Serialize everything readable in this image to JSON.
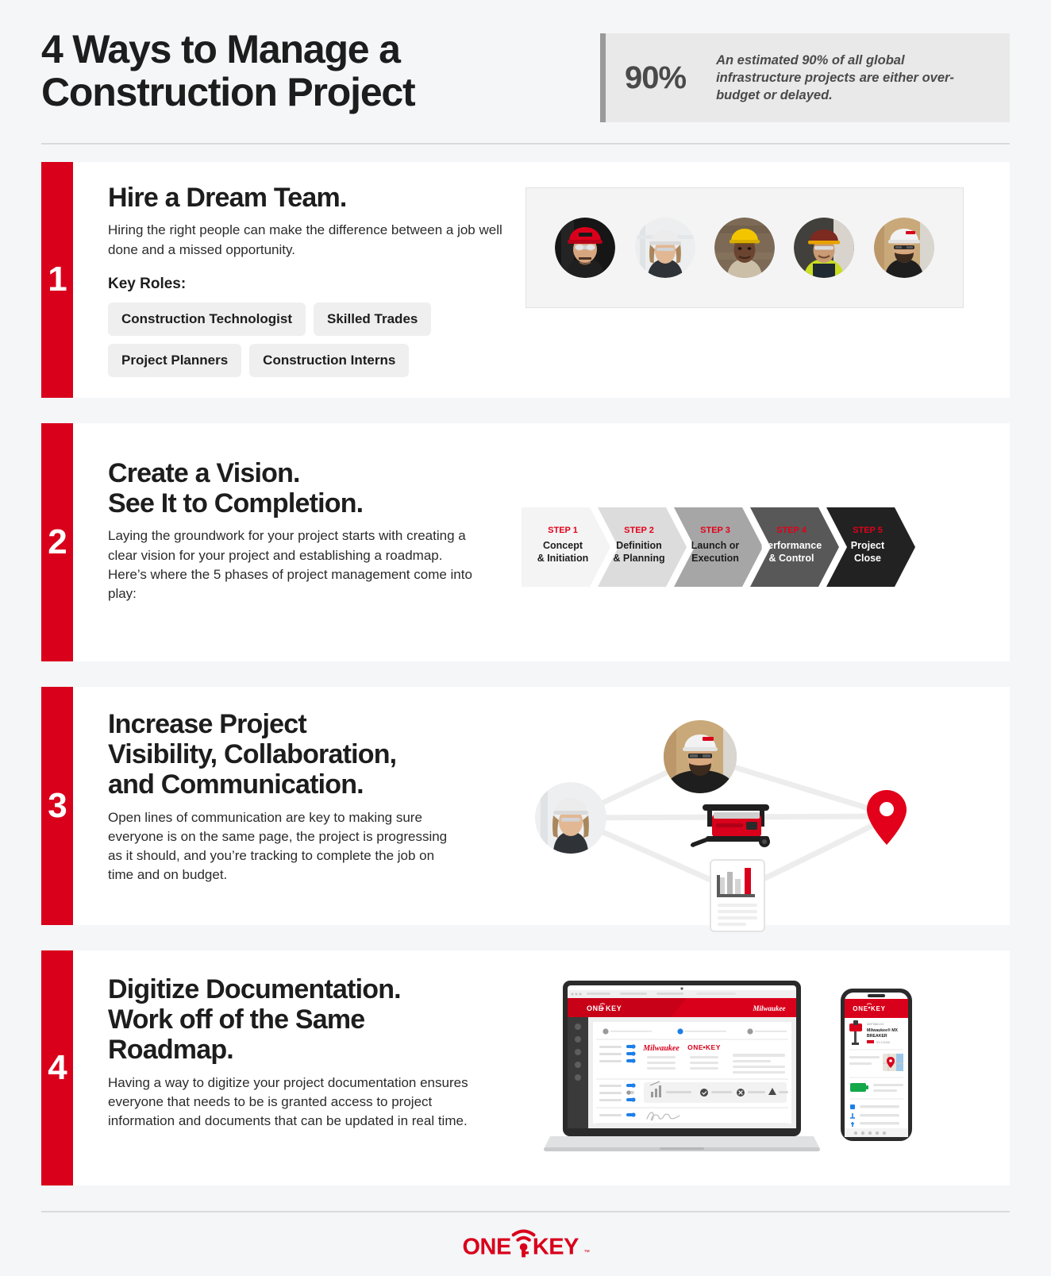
{
  "header": {
    "title_line1": "4 Ways to Manage a",
    "title_line2": "Construction Project",
    "stat_number": "90%",
    "stat_text": "An estimated 90% of all global infrastructure projects are either over-budget or delayed."
  },
  "sections": [
    {
      "number": "1",
      "title_lines": [
        "Hire a Dream Team."
      ],
      "description": "Hiring the right people can make the difference between a job well done and a missed opportunity.",
      "sub_label": "Key Roles:",
      "pills": [
        "Construction Technologist",
        "Skilled Trades",
        "Project Planners",
        "Construction Interns"
      ],
      "art": "team-photo-strip",
      "avatars": [
        {
          "name": "worker-red-hardhat",
          "helmet": "#d9001b",
          "skin": "#d7a67f",
          "bg": "#1a1a1a",
          "hair": "#3a2a1c"
        },
        {
          "name": "worker-white-hardhat-female",
          "helmet": "#e8e8e8",
          "skin": "#e2b894",
          "bg": "#e9ebec",
          "hair": "#a9865c"
        },
        {
          "name": "worker-yellow-hardhat",
          "helmet": "#f2c500",
          "skin": "#6b4430",
          "bg": "#7a6654",
          "hair": "#271a12"
        },
        {
          "name": "worker-brown-hardhat",
          "helmet": "#7d2a20",
          "skin": "#c99a73",
          "bg": "#3d3a36",
          "hair": "#2b2118"
        },
        {
          "name": "worker-white-hardhat-beard",
          "helmet": "#f2f2f2",
          "skin": "#d8a87e",
          "bg": "#c9a979",
          "hair": "#3b2b1e"
        }
      ]
    },
    {
      "number": "2",
      "title_lines": [
        "Create a Vision.",
        "See It to Completion."
      ],
      "description": "Laying the groundwork for your project starts with creating a clear vision for your project and establishing a roadmap. Here’s where the 5 phases of project management come into play:",
      "art": "process-chevrons"
    },
    {
      "number": "3",
      "title_lines": [
        "Increase Project",
        "Visibility, Collaboration,",
        "and Communication."
      ],
      "description": "Open lines of communication are key to making sure everyone is on the same page, the project is progressing as it should, and you’re tracking to complete the job on time and on budget.",
      "art": "collaboration-network"
    },
    {
      "number": "4",
      "title_lines": [
        "Digitize Documentation.",
        "Work off of the Same",
        "Roadmap."
      ],
      "description": "Having a way to digitize your project documentation ensures everyone that needs to be is granted access to project information and documents that can be updated in real time.",
      "art": "device-mockups"
    }
  ],
  "chart_data": {
    "type": "diagram",
    "diagram_type": "process-chevron",
    "title": "5 phases of project management",
    "steps": [
      {
        "step_label": "STEP 1",
        "line1": "Concept",
        "line2": "& Initiation",
        "fill": "#f4f4f4",
        "text_color": "#1d1d1d"
      },
      {
        "step_label": "STEP 2",
        "line1": "Definition",
        "line2": "& Planning",
        "fill": "#dcdcdc",
        "text_color": "#1d1d1d"
      },
      {
        "step_label": "STEP 3",
        "line1": "Launch or",
        "line2": "Execution",
        "fill": "#a6a6a6",
        "text_color": "#1d1d1d"
      },
      {
        "step_label": "STEP 4",
        "line1": "Performance",
        "line2": "& Control",
        "fill": "#585858",
        "text_color": "#ffffff"
      },
      {
        "step_label": "STEP 5",
        "line1": "Project",
        "line2": "Close",
        "fill": "#222222",
        "text_color": "#ffffff"
      }
    ],
    "step_label_color": "#e2001a"
  },
  "network": {
    "nodes": [
      {
        "name": "worker-female-node",
        "type": "avatar"
      },
      {
        "name": "worker-male-node",
        "type": "avatar"
      },
      {
        "name": "tool-generator-node",
        "type": "tool"
      },
      {
        "name": "report-document-node",
        "type": "document"
      },
      {
        "name": "location-pin-node",
        "type": "map-pin"
      }
    ],
    "link_color": "#ededed",
    "pin_color": "#e2001a"
  },
  "devices": {
    "laptop": {
      "app_name": "ONE-KEY",
      "brand": "Milwaukee",
      "brand_color": "#e2001a"
    },
    "phone": {
      "app_name": "ONE-KEY",
      "tool_sku": "MXF368-1XC",
      "tool_name_line1": "Milwaukee® MX",
      "tool_name_line2": "BREAKER"
    }
  },
  "footer": {
    "logo_text_left": "ONE",
    "logo_text_right": "KEY",
    "logo_trademark": "™",
    "logo_color": "#d9001b"
  },
  "colors": {
    "page_bg": "#f4f6f8",
    "card_bg": "#ffffff",
    "accent_red": "#d9001b",
    "divider": "#d8dadd",
    "pill_bg": "#efefef",
    "stat_bg": "#e9e9e9",
    "stat_bar": "#9a9a9a"
  }
}
